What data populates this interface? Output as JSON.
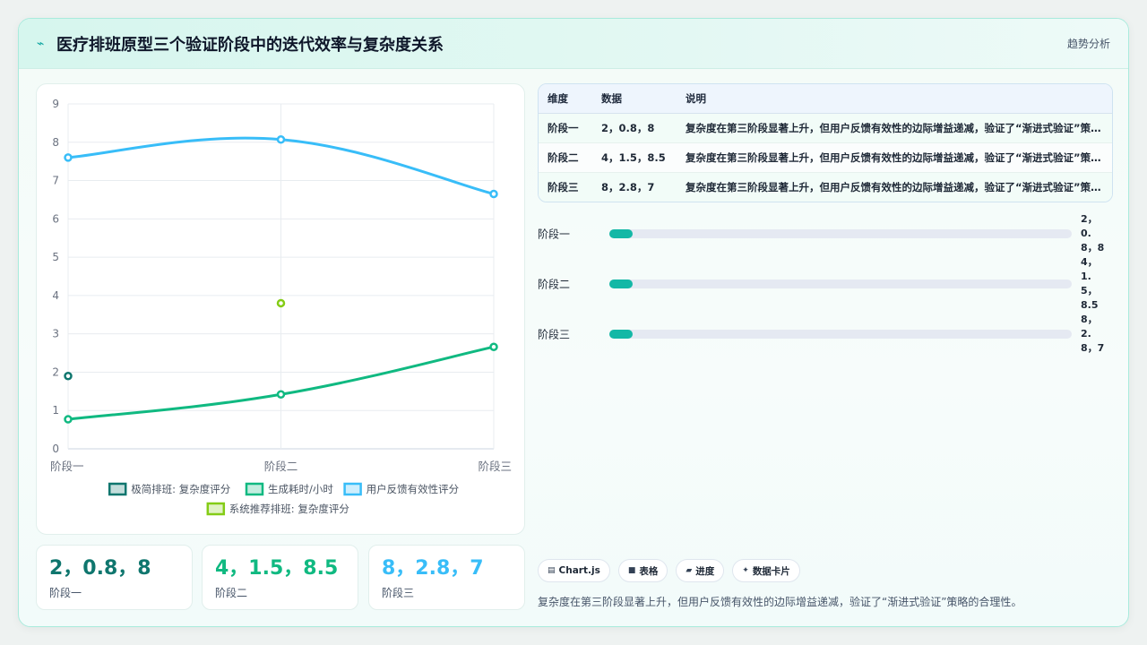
{
  "header": {
    "title": "医疗排班原型三个验证阶段中的迭代效率与复杂度关系",
    "tag": "趋势分析"
  },
  "chart_data": {
    "type": "line",
    "categories": [
      "阶段一",
      "阶段二",
      "阶段三"
    ],
    "ylim": [
      0,
      9
    ],
    "yticks": [
      0,
      1,
      2,
      3,
      4,
      5,
      6,
      7,
      8,
      9
    ],
    "grid": true,
    "legend_position": "bottom",
    "series": [
      {
        "name": "极简排班: 复杂度评分",
        "values": [
          1.9,
          null,
          null
        ],
        "color": "#0f766e"
      },
      {
        "name": "生成耗时/小时",
        "values": [
          0.77,
          1.42,
          2.66
        ],
        "color": "#10b981"
      },
      {
        "name": "用户反馈有效性评分",
        "values": [
          7.6,
          8.07,
          6.65
        ],
        "color": "#38bdf8"
      },
      {
        "name": "系统推荐排班: 复杂度评分",
        "values": [
          null,
          3.8,
          null
        ],
        "color": "#84cc16"
      }
    ]
  },
  "kpis": [
    {
      "value": "2，0.8，8",
      "label": "阶段一",
      "color": "#0f766e"
    },
    {
      "value": "4，1.5，8.5",
      "label": "阶段二",
      "color": "#10b981"
    },
    {
      "value": "8，2.8，7",
      "label": "阶段三",
      "color": "#38bdf8"
    }
  ],
  "table": {
    "headers": [
      "维度",
      "数据",
      "说明"
    ],
    "rows": [
      [
        "阶段一",
        "2，0.8，8",
        "复杂度在第三阶段显著上升，但用户反馈有效性的边际增益递减，验证了“渐进式验证”策略的合理性。"
      ],
      [
        "阶段二",
        "4，1.5，8.5",
        "复杂度在第三阶段显著上升，但用户反馈有效性的边际增益递减，验证了“渐进式验证”策略的合理性。"
      ],
      [
        "阶段三",
        "8，2.8，7",
        "复杂度在第三阶段显著上升，但用户反馈有效性的边际增益递减，验证了“渐进式验证”策略的合理性。"
      ]
    ]
  },
  "progress": [
    {
      "label": "阶段一",
      "value": "2，0.8，8",
      "fraction": 0.05
    },
    {
      "label": "阶段二",
      "value": "4，1.5，8.5",
      "fraction": 0.05
    },
    {
      "label": "阶段三",
      "value": "8，2.8，7",
      "fraction": 0.05
    }
  ],
  "tabs": [
    {
      "icon": "▤",
      "label": "Chart.js",
      "icon_name": "chart-icon"
    },
    {
      "icon": "■",
      "label": "表格",
      "icon_name": "table-icon"
    },
    {
      "icon": "▰",
      "label": "进度",
      "icon_name": "progress-icon"
    },
    {
      "icon": "✦",
      "label": "数据卡片",
      "icon_name": "sparkle-icon"
    }
  ],
  "summary": "复杂度在第三阶段显著上升，但用户反馈有效性的边际增益递减，验证了“渐进式验证”策略的合理性。"
}
